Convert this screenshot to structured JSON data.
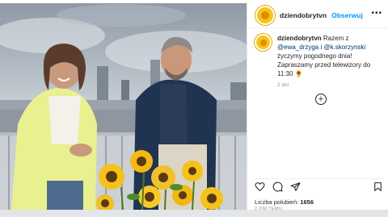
{
  "post": {
    "username": "dziendobrytvn",
    "follow_label": "Obserwuj",
    "more_label": "•••",
    "caption_user": "dziendobrytvn",
    "caption_lead": "Razem z",
    "mention_1": "@ewa_drzyga",
    "conj": "i",
    "mention_2": "@k.skorzynski",
    "caption_body": "życzymy pogodnego dnia! Zapraszamy przed telewizory do 11:30 🌻",
    "time_ago": "2 dni",
    "add_symbol": "+",
    "likes_label": "Liczba polubień:",
    "likes_count": "1656",
    "post_date": "2 DNI TEMU"
  },
  "icons": [
    "heart-icon",
    "comment-icon",
    "share-icon",
    "bookmark-icon",
    "add-icon",
    "more-icon"
  ],
  "colors": {
    "accent": "#0095f6",
    "text": "#262626",
    "muted": "#8e8e8e",
    "avatar": "#f5c518"
  }
}
